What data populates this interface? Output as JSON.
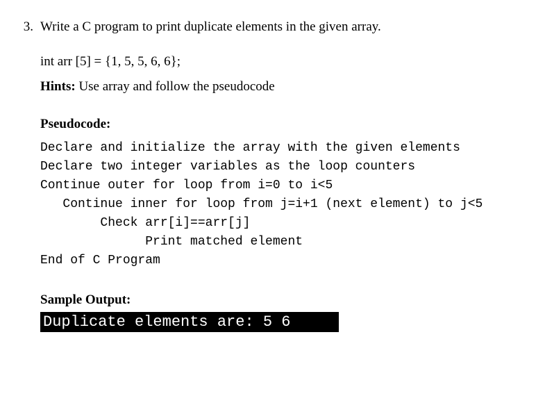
{
  "question": {
    "number": "3.",
    "text": "Write a C program to print duplicate elements in the given array."
  },
  "declaration": "int arr [5] = {1, 5, 5, 6, 6};",
  "hints": {
    "label": "Hints:",
    "text": " Use array and follow the pseudocode"
  },
  "pseudocode": {
    "heading": "Pseudocode:",
    "lines": "Declare and initialize the array with the given elements\nDeclare two integer variables as the loop counters\nContinue outer for loop from i=0 to i<5\n   Continue inner for loop from j=i+1 (next element) to j<5\n        Check arr[i]==arr[j]\n              Print matched element\nEnd of C Program"
  },
  "sample": {
    "heading": "Sample Output:",
    "output": "Duplicate elements are: 5 6"
  }
}
